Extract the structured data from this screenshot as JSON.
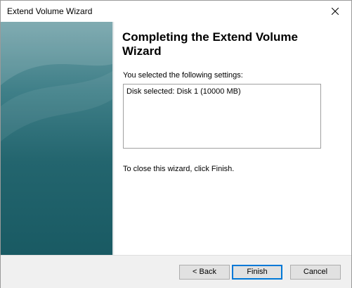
{
  "window": {
    "title": "Extend Volume Wizard",
    "close_icon": "close-icon"
  },
  "content": {
    "heading": "Completing the Extend Volume Wizard",
    "subtext": "You selected the following settings:",
    "settings": [
      "Disk selected: Disk 1 (10000 MB)"
    ],
    "close_instruction": "To close this wizard, click Finish."
  },
  "footer": {
    "back_label": "< Back",
    "finish_label": "Finish",
    "cancel_label": "Cancel"
  },
  "colors": {
    "sidebar_teal": "#23656e",
    "default_button_border": "#0078d7",
    "footer_bg": "#f0f0f0"
  }
}
